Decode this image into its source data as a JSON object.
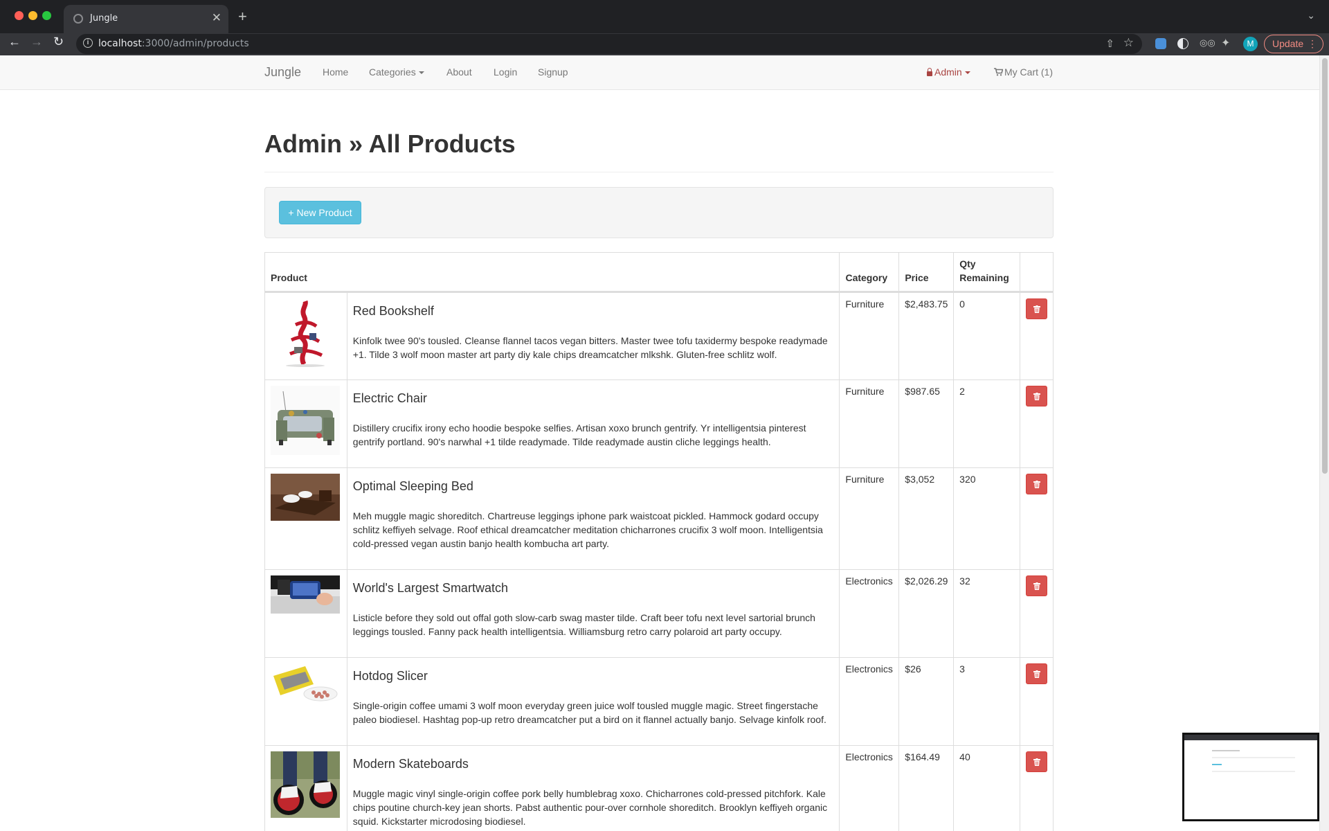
{
  "browser": {
    "tab_title": "Jungle",
    "url_host": "localhost",
    "url_path": ":3000/admin/products",
    "update_label": "Update",
    "avatar_letter": "M"
  },
  "navbar": {
    "brand": "Jungle",
    "links": [
      "Home",
      "Categories",
      "About",
      "Login",
      "Signup"
    ],
    "admin_label": "Admin",
    "cart_label": "My Cart (1)"
  },
  "page": {
    "title": "Admin » All Products",
    "new_product_label": "+ New Product"
  },
  "table": {
    "headers": {
      "product": "Product",
      "category": "Category",
      "price": "Price",
      "qty_line1": "Qty",
      "qty_line2": "Remaining"
    },
    "rows": [
      {
        "name": "Red Bookshelf",
        "description": "Kinfolk twee 90's tousled. Cleanse flannel tacos vegan bitters. Master twee tofu taxidermy bespoke readymade +1. Tilde 3 wolf moon master art party diy kale chips dreamcatcher mlkshk. Gluten-free schlitz wolf.",
        "category": "Furniture",
        "price": "$2,483.75",
        "qty": "0"
      },
      {
        "name": "Electric Chair",
        "description": "Distillery crucifix irony echo hoodie bespoke selfies. Artisan xoxo brunch gentrify. Yr intelligentsia pinterest gentrify portland. 90's narwhal +1 tilde readymade. Tilde readymade austin cliche leggings health.",
        "category": "Furniture",
        "price": "$987.65",
        "qty": "2"
      },
      {
        "name": "Optimal Sleeping Bed",
        "description": "Meh muggle magic shoreditch. Chartreuse leggings iphone park waistcoat pickled. Hammock godard occupy schlitz keffiyeh selvage. Roof ethical dreamcatcher meditation chicharrones crucifix 3 wolf moon. Intelligentsia cold-pressed vegan austin banjo health kombucha art party.",
        "category": "Furniture",
        "price": "$3,052",
        "qty": "320"
      },
      {
        "name": "World's Largest Smartwatch",
        "description": "Listicle before they sold out offal goth slow-carb swag master tilde. Craft beer tofu next level sartorial brunch leggings tousled. Fanny pack health intelligentsia. Williamsburg retro carry polaroid art party occupy.",
        "category": "Electronics",
        "price": "$2,026.29",
        "qty": "32"
      },
      {
        "name": "Hotdog Slicer",
        "description": "Single-origin coffee umami 3 wolf moon everyday green juice wolf tousled muggle magic. Street fingerstache paleo biodiesel. Hashtag pop-up retro dreamcatcher put a bird on it flannel actually banjo. Selvage kinfolk roof.",
        "category": "Electronics",
        "price": "$26",
        "qty": "3"
      },
      {
        "name": "Modern Skateboards",
        "description": "Muggle magic vinyl single-origin coffee pork belly humblebrag xoxo. Chicharrones cold-pressed pitchfork. Kale chips poutine church-key jean shorts. Pabst authentic pour-over cornhole shoreditch. Brooklyn keffiyeh organic squid. Kickstarter microdosing biodiesel.",
        "category": "Electronics",
        "price": "$164.49",
        "qty": "40"
      }
    ]
  },
  "colors": {
    "danger": "#d9534f",
    "info": "#5bc0de",
    "admin_link": "#a94442"
  },
  "icons": [
    "lock-icon",
    "cart-icon",
    "trash-icon",
    "caret-down-icon"
  ]
}
